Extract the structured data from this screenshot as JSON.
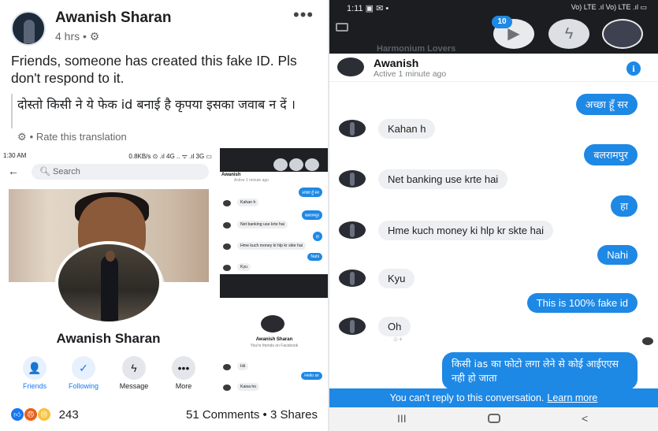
{
  "post": {
    "author": "Awanish Sharan",
    "time": "4 hrs • ⚙",
    "more": "•••",
    "text": "Friends, someone has created this fake ID. Pls don't respond to it.",
    "hindi_text": "दोस्तो किसी ने ये फेक id बनाई है कृपया इसका जवाब न दें ।",
    "rate_translation": "• Rate this translation",
    "reaction_count": "243",
    "comments_shares": "51 Comments • 3 Shares"
  },
  "profile_shot": {
    "status_left": "1:30 AM",
    "status_right": "0.8KB/s ⊙ .ıl 4G .. ᯤ .ıl 3G ▭",
    "search_placeholder": "Search",
    "name": "Awanish Sharan",
    "actions": [
      {
        "label": "Friends",
        "icon": "friends-icon"
      },
      {
        "label": "Following",
        "icon": "following-icon"
      },
      {
        "label": "Message",
        "icon": "messenger-icon"
      },
      {
        "label": "More",
        "icon": "more-icon"
      }
    ]
  },
  "mini_chat": {
    "header_name": "Awanish",
    "header_sub": "Active 1 minute ago",
    "messages": [
      {
        "side": "out",
        "text": "अच्छा हूँ सर"
      },
      {
        "side": "in",
        "text": "Kahan h"
      },
      {
        "side": "out",
        "text": "बलरामपुर"
      },
      {
        "side": "in",
        "text": "Net banking use krte hai"
      },
      {
        "side": "out",
        "text": "हा"
      },
      {
        "side": "in",
        "text": "Hme kuch money ki hlp kr skte hai"
      },
      {
        "side": "out",
        "text": "Nahi"
      },
      {
        "side": "in",
        "text": "Kyu"
      }
    ],
    "profile_name": "Awanish Sharan",
    "profile_sub": "You're friends on Facebook",
    "lower_messages": [
      {
        "side": "out",
        "text": "Hello sir"
      },
      {
        "side": "in",
        "text": "Hii"
      },
      {
        "side": "in",
        "text": "Kaisa ho"
      }
    ]
  },
  "messenger": {
    "status_time": "1:11",
    "status_icons": "▣ ✉ •",
    "status_right": "Vo) LTE .ıl Vo) LTE .ıl ▭",
    "badge": "10",
    "overlay_text": "Harmonium Lovers",
    "contact_name": "Awanish",
    "active_status": "Active 1 minute ago",
    "info": "i",
    "messages": [
      {
        "side": "out",
        "text": "अच्छा हूँ सर"
      },
      {
        "side": "in",
        "text": "Kahan h"
      },
      {
        "side": "out",
        "text": "बलरामपुर"
      },
      {
        "side": "in",
        "text": "Net banking use krte hai"
      },
      {
        "side": "out",
        "text": "हा"
      },
      {
        "side": "in",
        "text": "Hme kuch money ki hlp kr skte hai"
      },
      {
        "side": "out",
        "text": "Nahi"
      },
      {
        "side": "in",
        "text": "Kyu"
      },
      {
        "side": "out",
        "text": "This is 100% fake id"
      },
      {
        "side": "in",
        "text": "Oh"
      },
      {
        "side": "out",
        "text": "किसी ias का फोटो लगा लेने से कोई आईएएस नही हो जाता"
      }
    ],
    "cant_reply": "You can't reply to this conversation.",
    "learn_more": "Learn more",
    "nav_recent": "III",
    "nav_back": "<"
  },
  "colors": {
    "messenger_blue": "#1e88e5",
    "facebook_blue": "#1877f2"
  }
}
